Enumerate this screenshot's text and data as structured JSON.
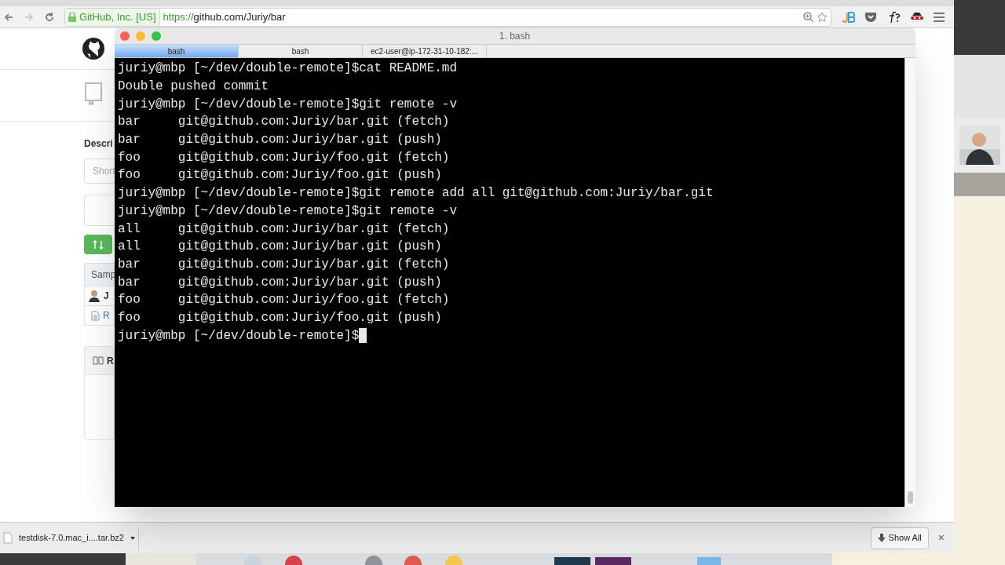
{
  "browser": {
    "address": {
      "identity": "GitHub, Inc. [US]",
      "scheme": "https://",
      "url": "github.com/Juriy/bar"
    }
  },
  "page": {
    "description_label": "Descri",
    "description_placeholder": "Short",
    "commits_header": "Samp",
    "author": "J",
    "file": "R",
    "readme": "R"
  },
  "terminal": {
    "title": "1. bash",
    "tabs": [
      {
        "label": "bash",
        "selected": true
      },
      {
        "label": "bash",
        "selected": false
      },
      {
        "label": "ec2-user@ip-172-31-10-182:...",
        "selected": false
      }
    ],
    "lines": [
      "juriy@mbp [~/dev/double-remote]$cat README.md",
      "Double pushed commit",
      "juriy@mbp [~/dev/double-remote]$git remote -v",
      "bar     git@github.com:Juriy/bar.git (fetch)",
      "bar     git@github.com:Juriy/bar.git (push)",
      "foo     git@github.com:Juriy/foo.git (fetch)",
      "foo     git@github.com:Juriy/foo.git (push)",
      "juriy@mbp [~/dev/double-remote]$git remote add all git@github.com:Juriy/bar.git",
      "juriy@mbp [~/dev/double-remote]$git remote -v",
      "all     git@github.com:Juriy/bar.git (fetch)",
      "all     git@github.com:Juriy/bar.git (push)",
      "bar     git@github.com:Juriy/bar.git (fetch)",
      "bar     git@github.com:Juriy/bar.git (push)",
      "foo     git@github.com:Juriy/foo.git (fetch)",
      "foo     git@github.com:Juriy/foo.git (push)",
      "juriy@mbp [~/dev/double-remote]$"
    ],
    "cursor": true
  },
  "downloads": {
    "file": "testdisk-7.0.mac_i....tar.bz2",
    "show_all": "Show All",
    "close": "×"
  }
}
